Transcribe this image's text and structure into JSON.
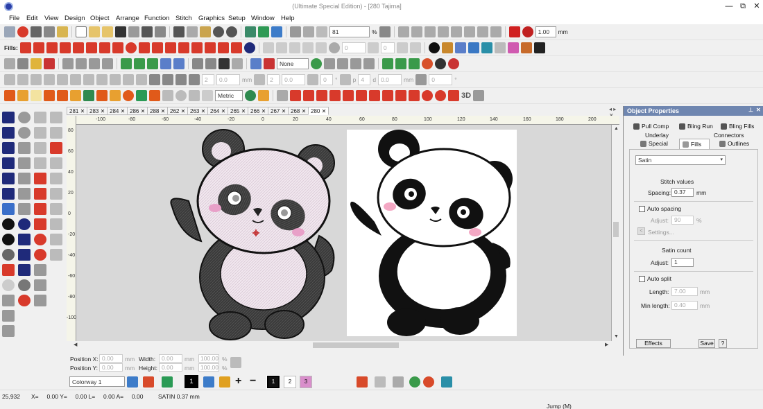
{
  "window": {
    "title": "(Ultimate Special Edition) - [280           Tajima]",
    "minimize": "—",
    "restore": "⧉",
    "close": "✕"
  },
  "menu": [
    "File",
    "Edit",
    "View",
    "Design",
    "Object",
    "Arrange",
    "Function",
    "Stitch",
    "Graphics",
    "Setup",
    "Window",
    "Help"
  ],
  "toolbar1": {
    "zoom": "81",
    "zoom_unit": "%",
    "size": "1.00",
    "size_unit": "mm"
  },
  "toolbar2": {
    "fills_label": "Fills:",
    "field_a": "0",
    "field_b": "0"
  },
  "toolbar3": {
    "none_option": "None"
  },
  "toolbar4": {
    "f1": "2",
    "f2": "0.0",
    "f1_unit": "mm",
    "f3": "2",
    "f4": "0.0",
    "f5": "0",
    "f6": "4",
    "f7": "0.0",
    "f8": "0",
    "mm_unit": "mm",
    "deg_unit": "°",
    "p_label": "p",
    "d_label": "d"
  },
  "toolbar5": {
    "metric": "Metric",
    "label_3d": "3D"
  },
  "doc_tabs": [
    "281",
    "283",
    "284",
    "286",
    "288",
    "262",
    "263",
    "264",
    "265",
    "266",
    "267",
    "268",
    "280"
  ],
  "ruler_h": [
    "-100",
    "-80",
    "-60",
    "-40",
    "-20",
    "0",
    "20",
    "40",
    "60",
    "80",
    "100",
    "120",
    "140",
    "160",
    "180",
    "200"
  ],
  "ruler_v": [
    "80",
    "60",
    "40",
    "20",
    "0",
    "-20",
    "-40",
    "-60",
    "-80",
    "-100"
  ],
  "position": {
    "x_label": "Position X:",
    "y_label": "Position Y:",
    "x": "0.00",
    "y": "0.00",
    "unit": "mm",
    "width_label": "Width:",
    "height_label": "Height:",
    "width": "0.00",
    "height": "0.00",
    "scale_w": "100.00",
    "scale_h": "100.00",
    "pct": "%"
  },
  "colorway": {
    "selected": "Colorway 1",
    "swatch1": "1",
    "swatch2": "2",
    "swatch3": "3"
  },
  "status": {
    "count": "25,932",
    "coords": "X=     0.00 Y=     0.00 L=     0.00 A=     0.00",
    "info": "SATIN 0.37 mm",
    "jump": "Jump (M)"
  },
  "props": {
    "title": "Object Properties",
    "tabs": {
      "pull_comp": "Pull Comp",
      "bling_run": "Bling Run",
      "bling_fills": "Bling Fills",
      "underlay": "Underlay",
      "connectors": "Connectors",
      "special": "Special",
      "fills": "Fills",
      "outlines": "Outlines"
    },
    "fill_type": "Satin",
    "stitch_values": "Stitch values",
    "spacing_label": "Spacing:",
    "spacing": "0.37",
    "auto_spacing": "Auto spacing",
    "adjust_label": "Adjust:",
    "adjust": "90",
    "settings": "Settings...",
    "satin_count": "Satin count",
    "satin_adjust_label": "Adjust:",
    "satin_adjust": "1",
    "auto_split": "Auto split",
    "length_label": "Length:",
    "length": "7.00",
    "min_length_label": "Min length:",
    "min_length": "0.40",
    "mm": "mm",
    "pct": "%",
    "effects": "Effects",
    "save": "Save",
    "help": "?"
  }
}
